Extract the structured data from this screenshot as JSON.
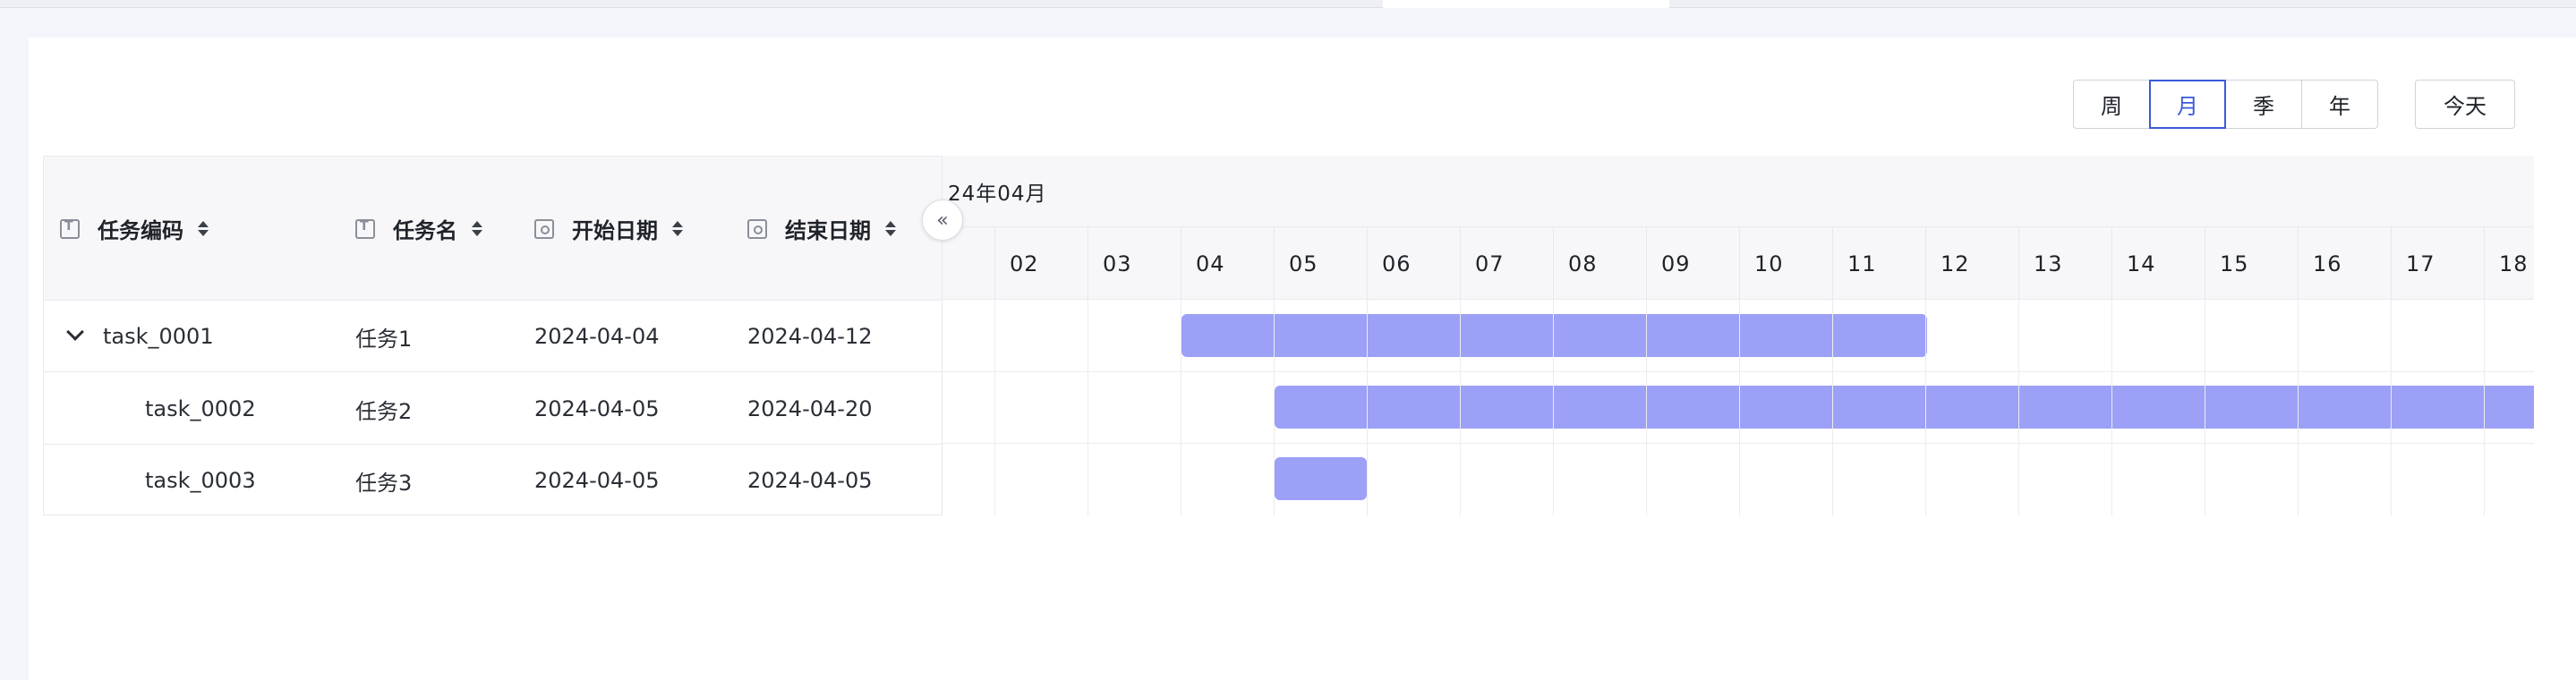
{
  "toolbar": {
    "views": [
      "周",
      "月",
      "季",
      "年"
    ],
    "active_view": "月",
    "today_label": "今天"
  },
  "table": {
    "columns": [
      {
        "label": "任务编码",
        "icon": "text-field-icon"
      },
      {
        "label": "任务名",
        "icon": "text-field-icon"
      },
      {
        "label": "开始日期",
        "icon": "date-field-icon"
      },
      {
        "label": "结束日期",
        "icon": "date-field-icon"
      }
    ],
    "rows": [
      {
        "code": "task_0001",
        "name": "任务1",
        "start": "2024-04-04",
        "end": "2024-04-12",
        "expandable": true
      },
      {
        "code": "task_0002",
        "name": "任务2",
        "start": "2024-04-05",
        "end": "2024-04-20",
        "expandable": false
      },
      {
        "code": "task_0003",
        "name": "任务3",
        "start": "2024-04-05",
        "end": "2024-04-05",
        "expandable": false
      }
    ]
  },
  "gantt": {
    "month_label": "24年04月",
    "days": [
      "02",
      "03",
      "04",
      "05",
      "06",
      "07",
      "08",
      "09",
      "10",
      "11",
      "12",
      "13",
      "14",
      "15",
      "16",
      "17",
      "18"
    ],
    "bar_color": "#9ca0f6"
  },
  "colors": {
    "accent": "#3a5bd9",
    "bar": "#9ca0f6",
    "header_bg": "#f7f7f9"
  }
}
